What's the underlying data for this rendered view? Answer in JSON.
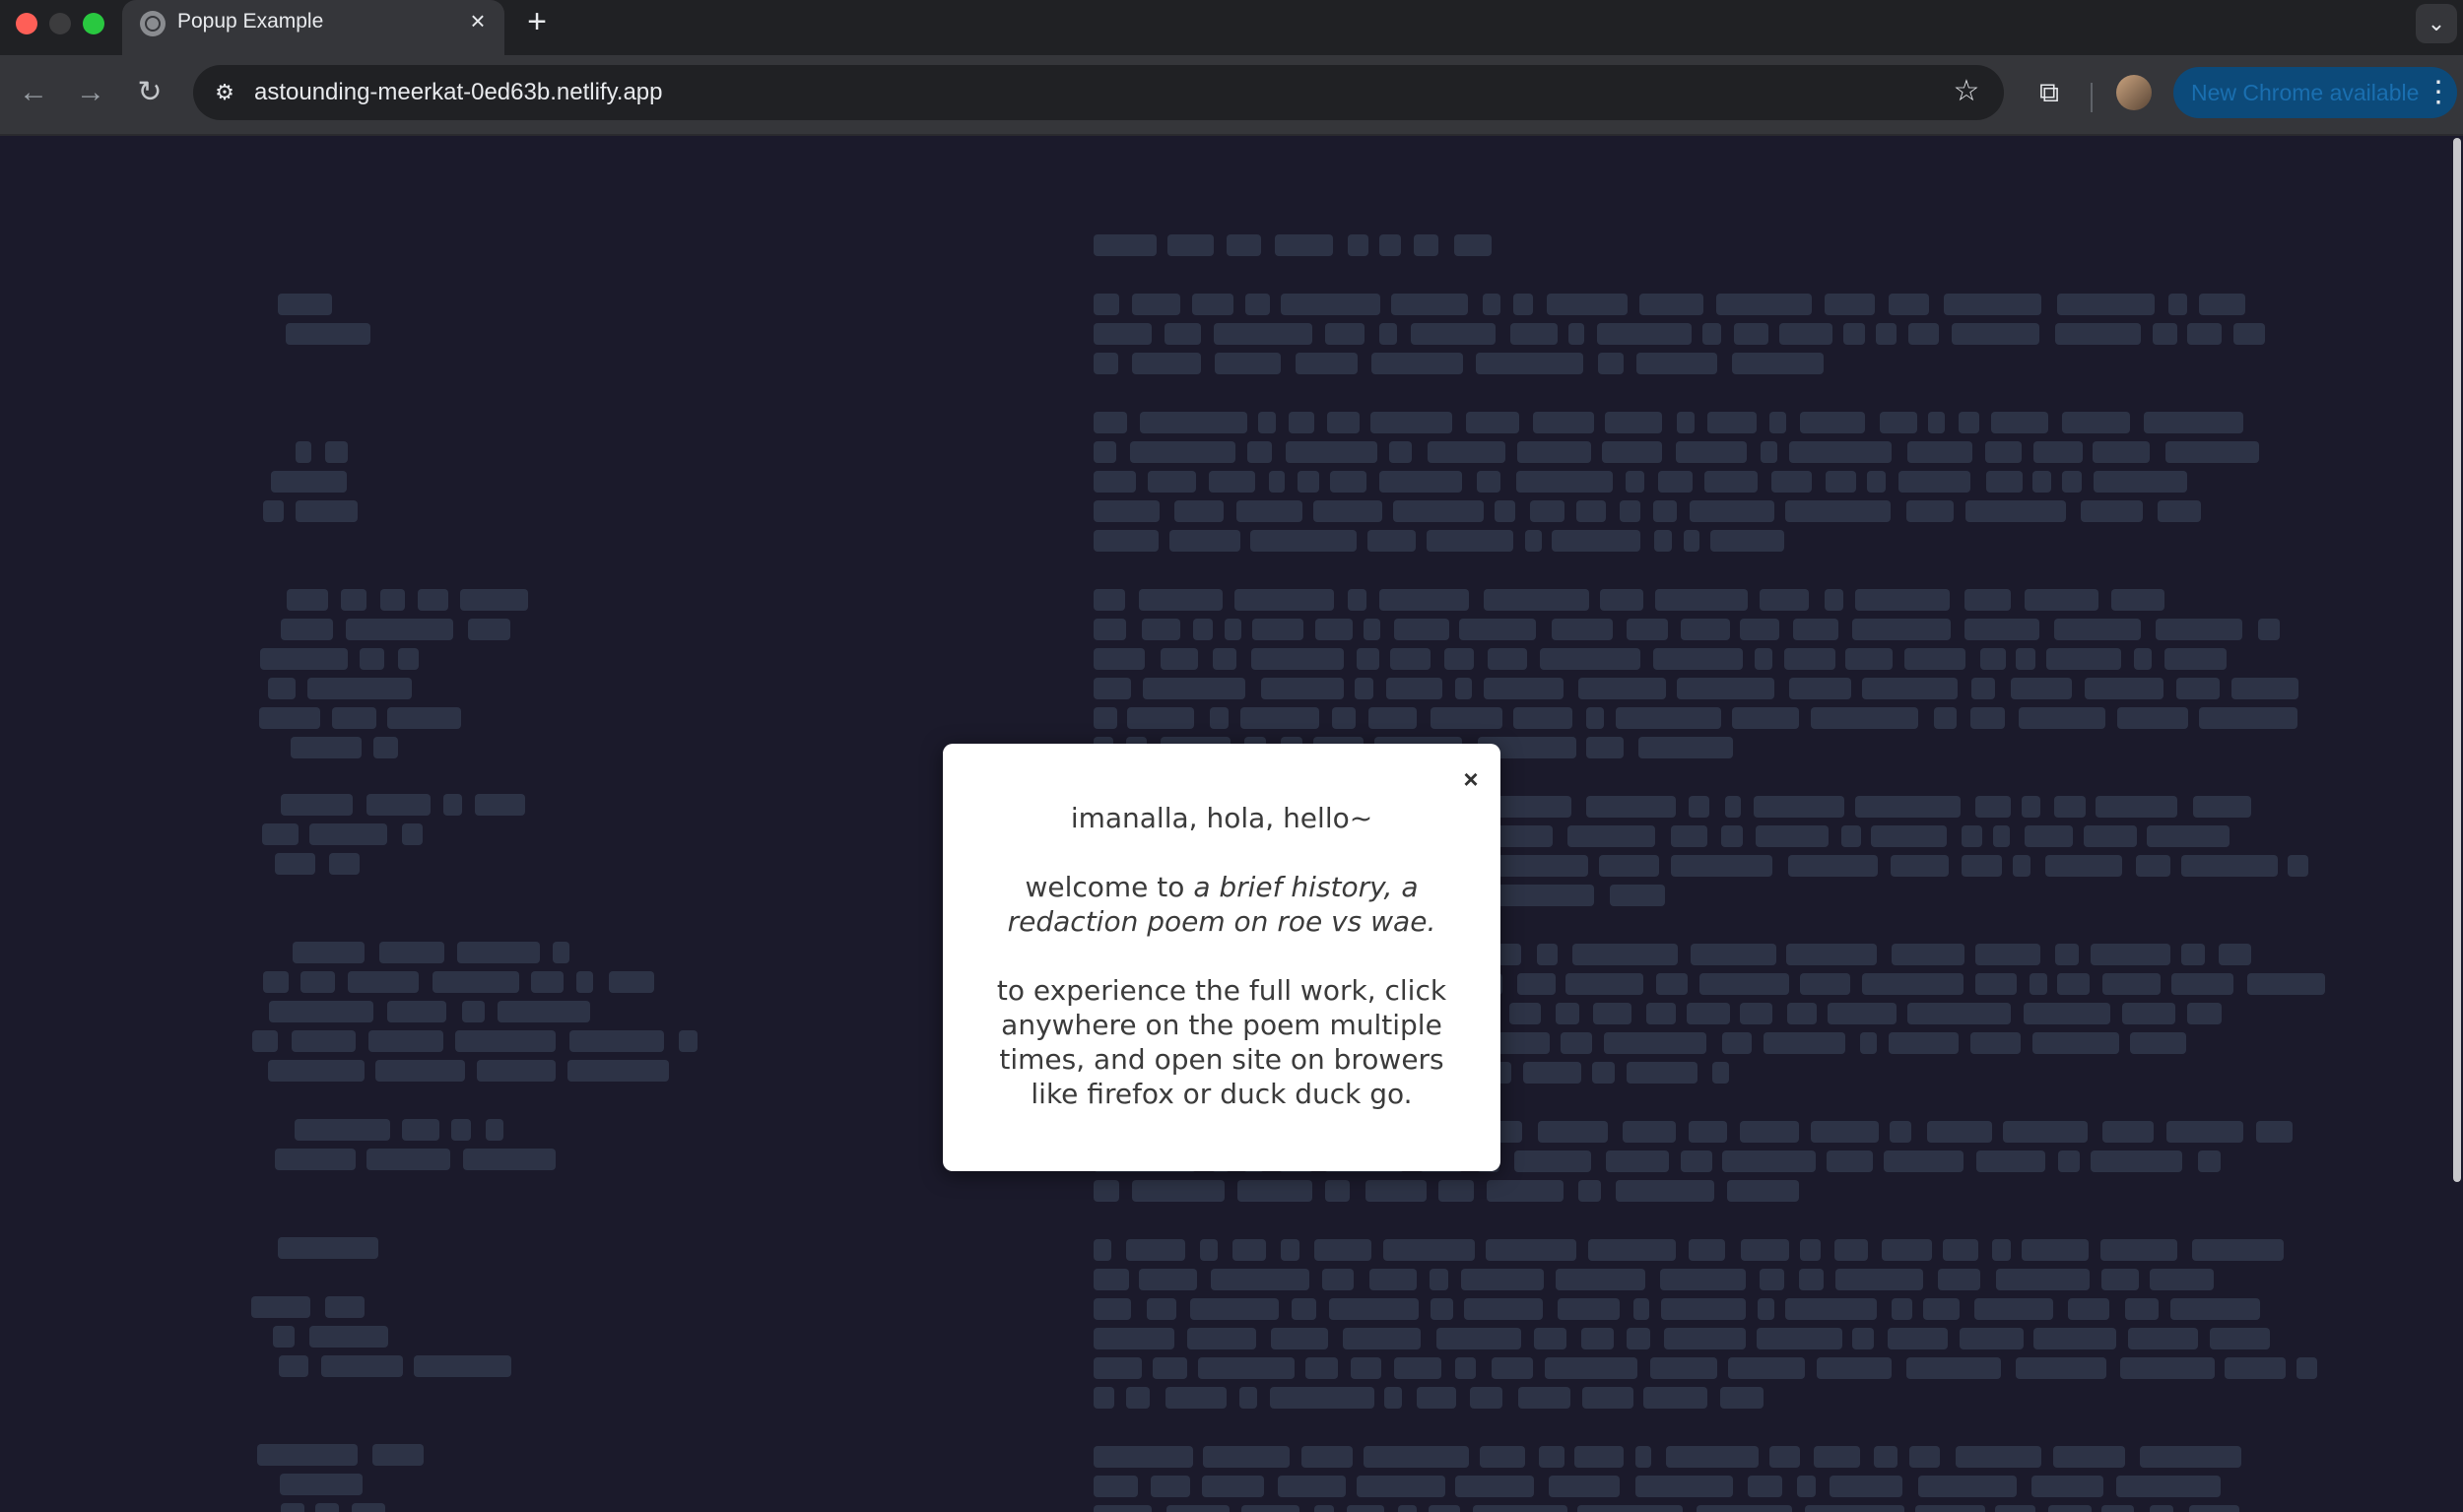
{
  "browser": {
    "tab": {
      "title": "Popup Example"
    },
    "url": "astounding-meerkat-0ed63b.netlify.app",
    "update_button": "New Chrome available"
  },
  "popup": {
    "close": "×",
    "greeting": "imanalla, hola, hello~",
    "welcome_prefix": "welcome to ",
    "welcome_title": "a brief history, a redaction poem on roe vs wae.",
    "instructions": "to experience the full work, click anywhere on the poem multiple times, and open site on browers like firefox or duck duck go."
  },
  "colors": {
    "page_background": "#1b1a2b",
    "redaction_block": "#2d3346",
    "popup_background": "#ffffff",
    "update_button": "#0c4a7a"
  }
}
